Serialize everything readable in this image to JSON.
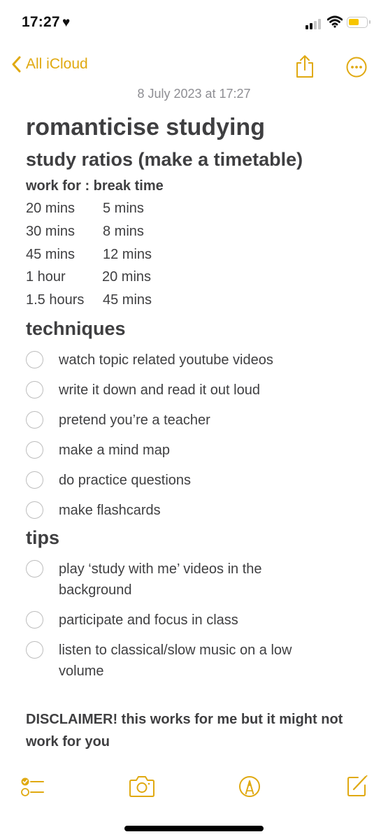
{
  "status_bar": {
    "time": "17:27",
    "heart_glyph": "♥",
    "icons": [
      "signal-icon",
      "wifi-icon",
      "battery-icon"
    ],
    "battery_level": 0.5,
    "battery_color": "#f7c500"
  },
  "nav": {
    "back_label": "All iCloud",
    "actions": [
      "share-icon",
      "more-icon"
    ],
    "accent_color": "#e0a911"
  },
  "note": {
    "date": "8 July 2023 at 17:27",
    "title": "romanticise studying",
    "sections": {
      "ratios": {
        "heading": "study ratios (make a timetable)",
        "subheading": "work for : break time",
        "rows": [
          {
            "work": "20 mins",
            "break": "5 mins"
          },
          {
            "work": "30 mins",
            "break": "8 mins"
          },
          {
            "work": "45 mins",
            "break": "12 mins"
          },
          {
            "work": "1 hour",
            "break": "20 mins"
          },
          {
            "work": "1.5 hours",
            "break": "45 mins"
          }
        ]
      },
      "techniques": {
        "heading": "techniques",
        "items": [
          {
            "text": "watch topic related youtube videos",
            "checked": false
          },
          {
            "text": "write it down and read it out loud",
            "checked": false
          },
          {
            "text": "pretend you’re a teacher",
            "checked": false
          },
          {
            "text": "make a mind map",
            "checked": false
          },
          {
            "text": "do practice questions",
            "checked": false
          },
          {
            "text": "make flashcards",
            "checked": false
          }
        ]
      },
      "tips": {
        "heading": "tips",
        "items": [
          {
            "text": "play ‘study with me’ videos in the background",
            "checked": false
          },
          {
            "text": "participate and focus in class",
            "checked": false
          },
          {
            "text": "listen to classical/slow music on a low volume",
            "checked": false
          }
        ]
      }
    },
    "disclaimer": "DISCLAIMER! this works for me but it might not work for you"
  },
  "toolbar": {
    "icons": [
      "checklist-icon",
      "camera-icon",
      "markup-icon",
      "compose-icon"
    ]
  }
}
